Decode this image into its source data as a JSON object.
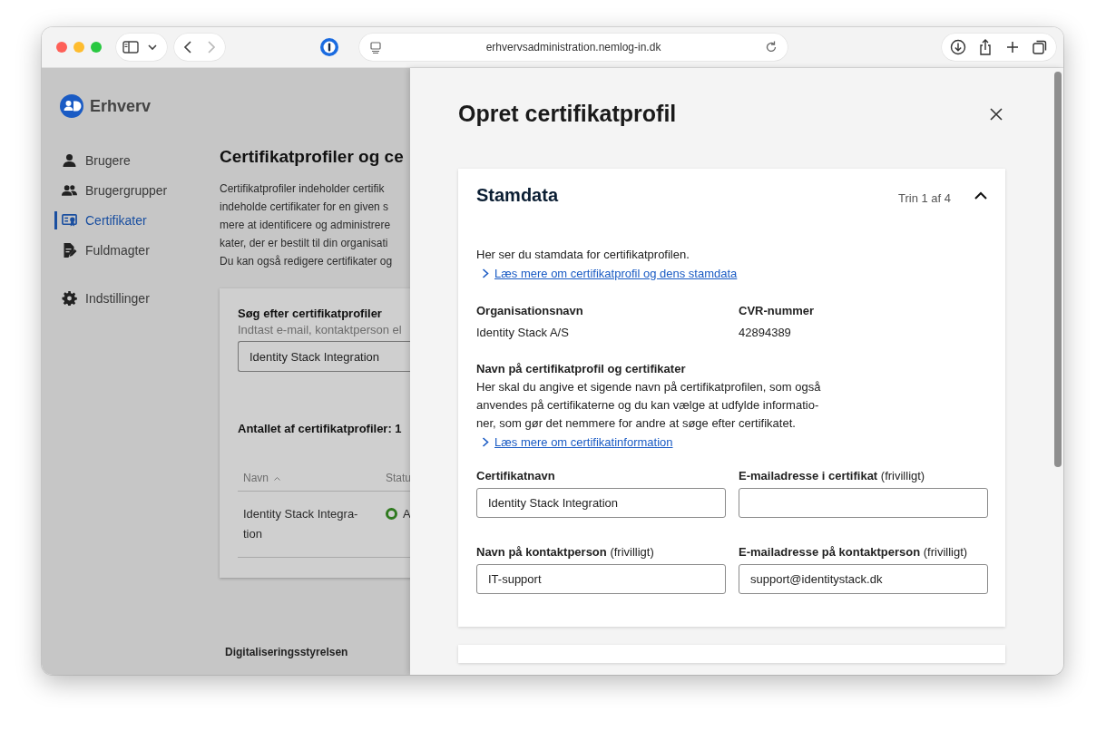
{
  "browser": {
    "url": "erhvervsadministration.nemlog-in.dk",
    "nav": [
      {
        "kind": "back",
        "disabled": false
      },
      {
        "kind": "forward",
        "disabled": true
      }
    ]
  },
  "sidebar": {
    "brand": "Erhverv",
    "items": [
      {
        "label": "Brugere",
        "kind": "user",
        "selected": false
      },
      {
        "label": "Brugergrupper",
        "kind": "users",
        "selected": false
      },
      {
        "label": "Certifikater",
        "kind": "certificate",
        "selected": true
      },
      {
        "label": "Fuldmagter",
        "kind": "document",
        "selected": false
      }
    ],
    "settings_items": [
      {
        "label": "Indstillinger",
        "kind": "gear",
        "selected": false
      }
    ]
  },
  "page": {
    "heading": "Certifikatprofiler og ce",
    "intro": "Certifikatprofiler indeholder certifik\nindeholde certifikater for en given s\nmere at identificere og administrere\nkater, der er bestilt til din organisati\nDu kan også redigere certifikater og",
    "search": {
      "title": "Søg efter certifikatprofiler",
      "hint": "Indtast e-mail, kontaktperson el",
      "value": "Identity Stack Integration"
    },
    "count": "Antallet af certifikatprofiler: 1",
    "table": {
      "columns": [
        {
          "label": "Navn",
          "sorted": true
        },
        {
          "label": "Statu",
          "sorted": false
        }
      ],
      "rows": [
        {
          "name": "Identity Stack Integra-\ntion",
          "status": "A",
          "color": "#2f7a1f"
        }
      ]
    },
    "footer": "Digitaliseringsstyrelsen"
  },
  "drawer": {
    "title": "Opret certifikatprofil",
    "section": {
      "title": "Stamdata",
      "step": "Trin 1 af 4",
      "expanded": true,
      "intro": "Her ser du stamdata for certifikatprofilen.",
      "intro_link": "Læs mere om certifikatprofil og dens stamdata",
      "facts": [
        {
          "label": "Organisationsnavn",
          "value": "Identity Stack A/S"
        },
        {
          "label": "CVR-nummer",
          "value": "42894389"
        }
      ],
      "name_heading": "Navn på certifikatprofil og certifikater",
      "name_text": "Her skal du angive et sigende navn på certifikatprofilen, som også\nanvendes på certifikaterne og du kan vælge at udfylde informatio-\nner, som gør det nemmere for andre at søge efter certifikatet.",
      "name_link": "Læs mere om certifikatinformation",
      "fields": [
        {
          "label": "Certifikatnavn",
          "value": "Identity Stack Integration"
        },
        {
          "label": "E-mailadresse i certifikat",
          "note": "(frivilligt)"
        },
        {
          "label": "Navn på kontaktperson",
          "note": "(frivilligt)",
          "value": "IT-support"
        },
        {
          "label": "E-mailadresse på kontaktperson",
          "note": "(frivilligt)",
          "value": "support@identitystack.dk"
        }
      ]
    }
  }
}
